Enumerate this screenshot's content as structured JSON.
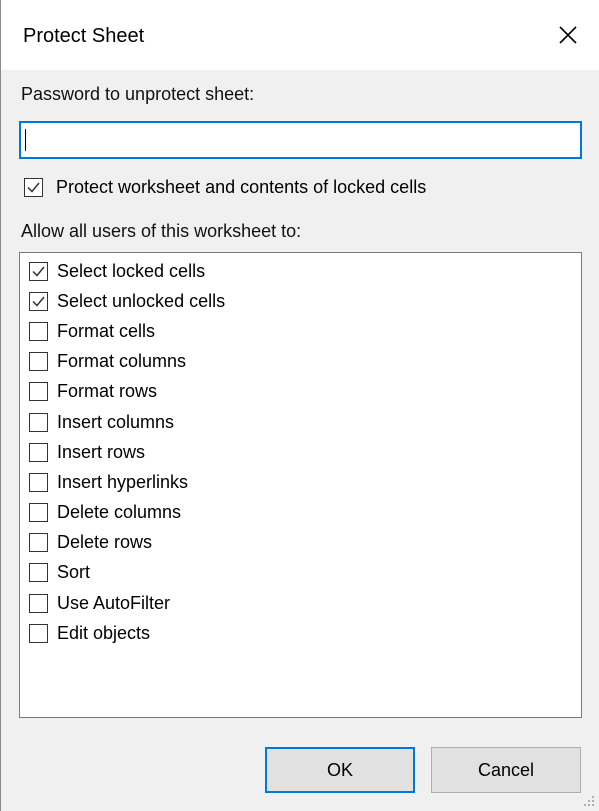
{
  "dialog": {
    "title": "Protect Sheet",
    "close_icon": "close-icon"
  },
  "password": {
    "label": "Password to unprotect sheet:",
    "value": ""
  },
  "protect": {
    "label": "Protect worksheet and contents of locked cells",
    "checked": true
  },
  "allow": {
    "label": "Allow all users of this worksheet to:",
    "items": [
      {
        "label": "Select locked cells",
        "checked": true
      },
      {
        "label": "Select unlocked cells",
        "checked": true
      },
      {
        "label": "Format cells",
        "checked": false
      },
      {
        "label": "Format columns",
        "checked": false
      },
      {
        "label": "Format rows",
        "checked": false
      },
      {
        "label": "Insert columns",
        "checked": false
      },
      {
        "label": "Insert rows",
        "checked": false
      },
      {
        "label": "Insert hyperlinks",
        "checked": false
      },
      {
        "label": "Delete columns",
        "checked": false
      },
      {
        "label": "Delete rows",
        "checked": false
      },
      {
        "label": "Sort",
        "checked": false
      },
      {
        "label": "Use AutoFilter",
        "checked": false
      },
      {
        "label": "Edit objects",
        "checked": false
      }
    ]
  },
  "buttons": {
    "ok": "OK",
    "cancel": "Cancel"
  },
  "colors": {
    "accent": "#0078d7",
    "background": "#f0f0f0"
  }
}
